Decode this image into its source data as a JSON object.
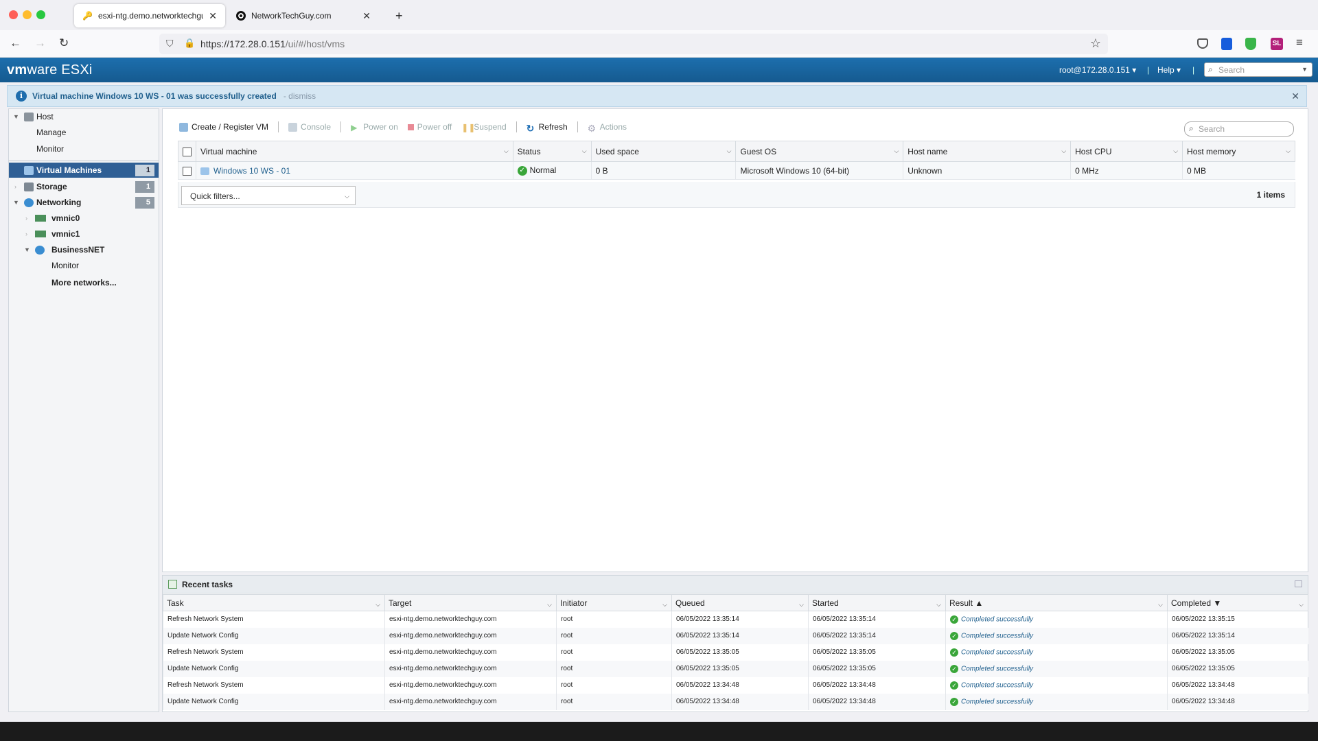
{
  "browser": {
    "tabs": [
      {
        "title": "esxi-ntg.demo.networktechguy.com",
        "close": "✕"
      },
      {
        "title": "NetworkTechGuy.com",
        "close": "✕"
      }
    ],
    "new_tab": "+",
    "url_host": "https://172.28.0.151",
    "url_path": "/ui/#/host/vms",
    "colors": {
      "red": "#fe5f57",
      "yellow": "#febc2e",
      "green": "#28c840"
    }
  },
  "header": {
    "logo_vm": "vm",
    "logo_ware": "ware",
    "logo_product": "ESXi",
    "user": "root@172.28.0.151 ▾",
    "help": "Help ▾",
    "sep": "|",
    "search_placeholder": "Search"
  },
  "notification": {
    "message": "Virtual machine Windows 10 WS - 01 was successfully created",
    "dismiss": "- dismiss",
    "close": "✕"
  },
  "sidebar": {
    "host": "Host",
    "manage": "Manage",
    "monitor": "Monitor",
    "virtual_machines": "Virtual Machines",
    "vm_count": "1",
    "storage": "Storage",
    "storage_count": "1",
    "networking": "Networking",
    "networking_count": "5",
    "vmnic0": "vmnic0",
    "vmnic1": "vmnic1",
    "businessnet": "BusinessNET",
    "net_monitor": "Monitor",
    "more_networks": "More networks..."
  },
  "toolbar": {
    "create": "Create / Register VM",
    "console": "Console",
    "power_on": "Power on",
    "power_off": "Power off",
    "suspend": "Suspend",
    "refresh": "Refresh",
    "actions": "Actions",
    "search_placeholder": "Search"
  },
  "vm_table": {
    "headers": [
      "Virtual machine",
      "Status",
      "Used space",
      "Guest OS",
      "Host name",
      "Host CPU",
      "Host memory"
    ],
    "row": {
      "name": "Windows 10 WS - 01",
      "status": "Normal",
      "used_space": "0 B",
      "guest_os": "Microsoft Windows 10 (64-bit)",
      "host_name": "Unknown",
      "host_cpu": "0 MHz",
      "host_memory": "0 MB"
    },
    "quick_filters": "Quick filters...",
    "item_count": "1 items"
  },
  "recent_tasks": {
    "title": "Recent tasks",
    "headers": [
      "Task",
      "Target",
      "Initiator",
      "Queued",
      "Started",
      "Result ▲",
      "Completed ▼"
    ],
    "rows": [
      {
        "task": "Refresh Network System",
        "target": "esxi-ntg.demo.networktechguy.com",
        "initiator": "root",
        "queued": "06/05/2022 13:35:14",
        "started": "06/05/2022 13:35:14",
        "result": "Completed successfully",
        "completed": "06/05/2022 13:35:15"
      },
      {
        "task": "Update Network Config",
        "target": "esxi-ntg.demo.networktechguy.com",
        "initiator": "root",
        "queued": "06/05/2022 13:35:14",
        "started": "06/05/2022 13:35:14",
        "result": "Completed successfully",
        "completed": "06/05/2022 13:35:14"
      },
      {
        "task": "Refresh Network System",
        "target": "esxi-ntg.demo.networktechguy.com",
        "initiator": "root",
        "queued": "06/05/2022 13:35:05",
        "started": "06/05/2022 13:35:05",
        "result": "Completed successfully",
        "completed": "06/05/2022 13:35:05"
      },
      {
        "task": "Update Network Config",
        "target": "esxi-ntg.demo.networktechguy.com",
        "initiator": "root",
        "queued": "06/05/2022 13:35:05",
        "started": "06/05/2022 13:35:05",
        "result": "Completed successfully",
        "completed": "06/05/2022 13:35:05"
      },
      {
        "task": "Refresh Network System",
        "target": "esxi-ntg.demo.networktechguy.com",
        "initiator": "root",
        "queued": "06/05/2022 13:34:48",
        "started": "06/05/2022 13:34:48",
        "result": "Completed successfully",
        "completed": "06/05/2022 13:34:48"
      },
      {
        "task": "Update Network Config",
        "target": "esxi-ntg.demo.networktechguy.com",
        "initiator": "root",
        "queued": "06/05/2022 13:34:48",
        "started": "06/05/2022 13:34:48",
        "result": "Completed successfully",
        "completed": "06/05/2022 13:34:48"
      }
    ]
  }
}
